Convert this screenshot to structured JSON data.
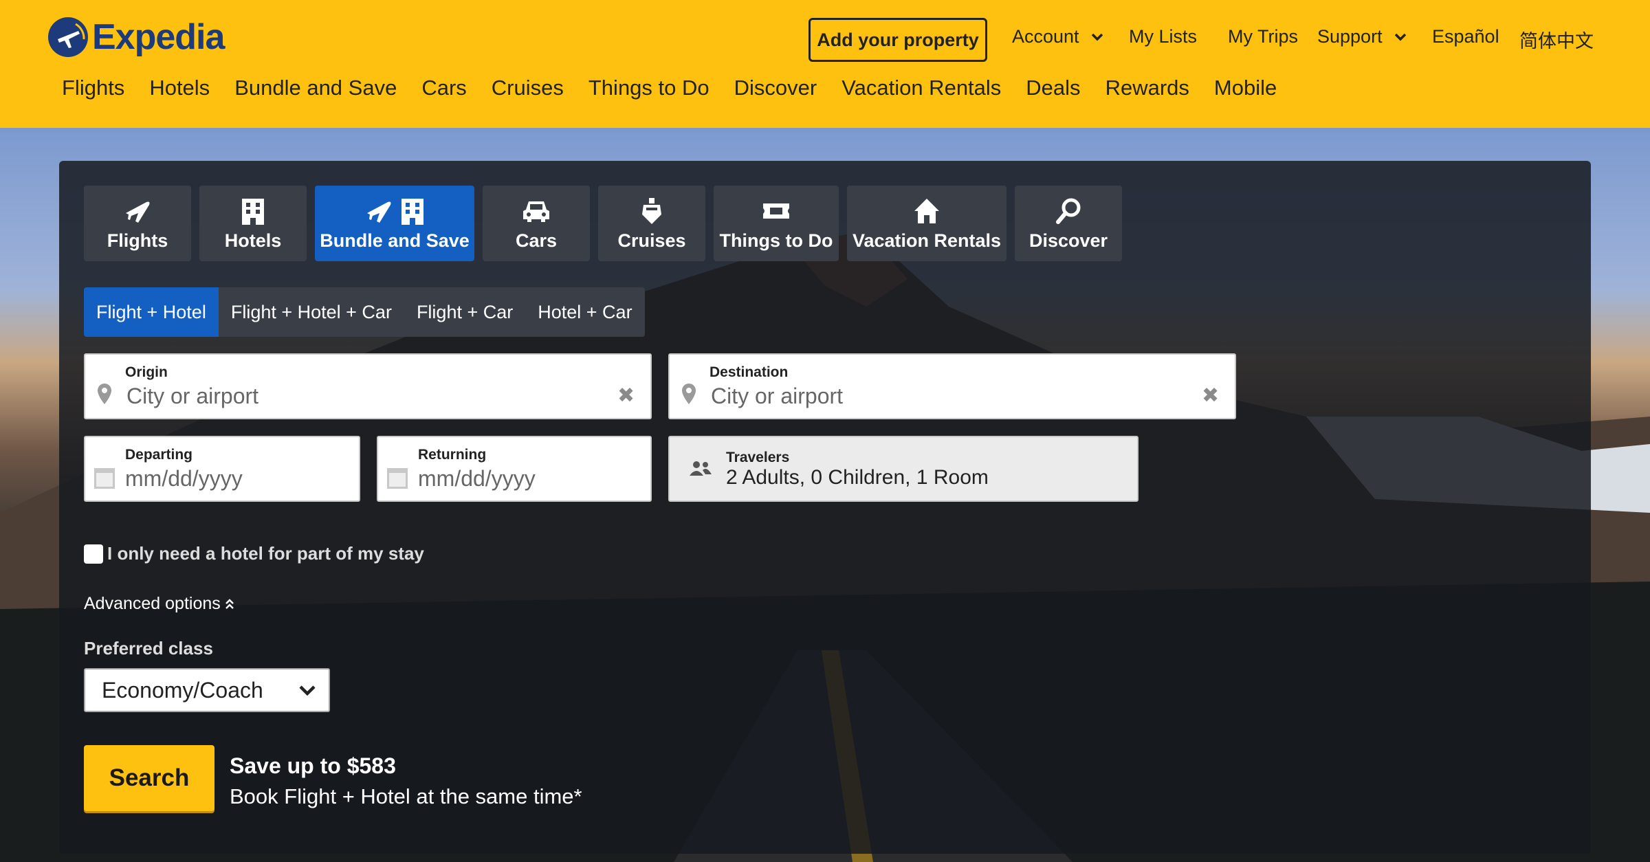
{
  "header": {
    "logo_text": "Expedia",
    "add_property": "Add your property",
    "account": "Account",
    "my_lists": "My Lists",
    "my_trips": "My Trips",
    "support": "Support",
    "espanol": "Español",
    "chinese": "简体中文",
    "nav": [
      "Flights",
      "Hotels",
      "Bundle and Save",
      "Cars",
      "Cruises",
      "Things to Do",
      "Discover",
      "Vacation Rentals",
      "Deals",
      "Rewards",
      "Mobile"
    ]
  },
  "product_tabs": [
    {
      "label": "Flights",
      "icon": "plane-icon"
    },
    {
      "label": "Hotels",
      "icon": "hotel-icon"
    },
    {
      "label": "Bundle and Save",
      "icon": "plane-hotel-icon",
      "active": true
    },
    {
      "label": "Cars",
      "icon": "car-icon"
    },
    {
      "label": "Cruises",
      "icon": "ship-icon"
    },
    {
      "label": "Things to Do",
      "icon": "ticket-icon"
    },
    {
      "label": "Vacation Rentals",
      "icon": "house-icon"
    },
    {
      "label": "Discover",
      "icon": "magnifier-icon"
    }
  ],
  "sub_tabs": [
    "Flight + Hotel",
    "Flight + Hotel + Car",
    "Flight + Car",
    "Hotel + Car"
  ],
  "form": {
    "origin_label": "Origin",
    "origin_placeholder": "City or airport",
    "destination_label": "Destination",
    "destination_placeholder": "City or airport",
    "departing_label": "Departing",
    "departing_placeholder": "mm/dd/yyyy",
    "returning_label": "Returning",
    "returning_placeholder": "mm/dd/yyyy",
    "travelers_label": "Travelers",
    "travelers_value": "2 Adults, 0 Children, 1 Room",
    "partial_stay": "I only need a hotel for part of my stay",
    "advanced": "Advanced options",
    "preferred_class_label": "Preferred class",
    "preferred_class_value": "Economy/Coach",
    "search": "Search",
    "promo_title": "Save up to $583",
    "promo_text": "Book Flight + Hotel at the same time*"
  },
  "colors": {
    "brand_yellow": "#fec10f",
    "active_blue": "#1460c2",
    "logo_blue": "#1d3a7a"
  }
}
